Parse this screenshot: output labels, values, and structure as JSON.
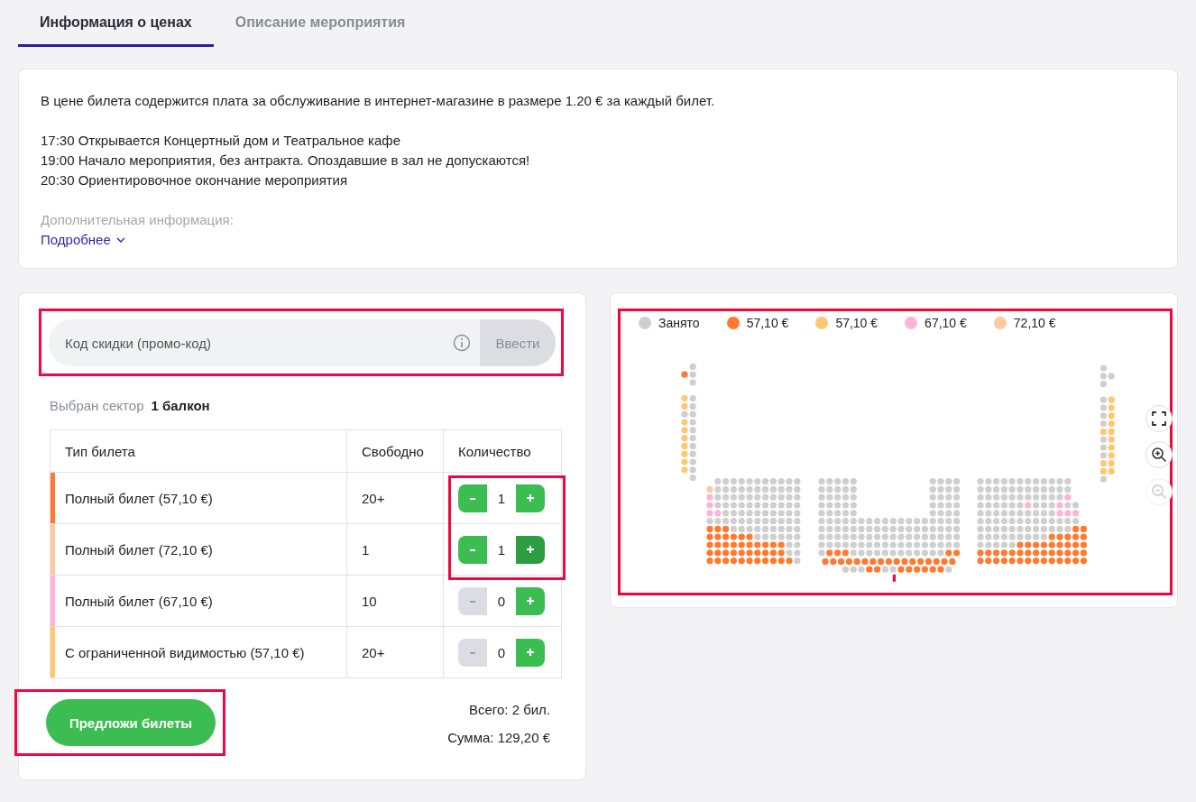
{
  "tabs": [
    {
      "label": "Информация о ценах",
      "selected": true
    },
    {
      "label": "Описание мероприятия",
      "selected": false
    }
  ],
  "info": {
    "fee_note": "В цене билета содержится плата за обслуживание в интернет-магазине в размере 1.20 € за каждый билет.",
    "schedule": [
      "17:30 Открывается Концертный дом и Театральное кафе",
      "19:00 Начало мероприятия, без антракта. Опоздавшие в зал не допускаются!",
      "20:30 Ориентировочное окончание мероприятия"
    ],
    "extra_label": "Дополнительная информация:",
    "more_link": "Подробнее"
  },
  "promo": {
    "placeholder": "Код скидки (промо-код)",
    "button": "Ввести",
    "highlighted": true
  },
  "sector": {
    "label": "Выбран сектор",
    "value": "1 балкон"
  },
  "table": {
    "columns": [
      "Тип билета",
      "Свободно",
      "Количество"
    ],
    "rows": [
      {
        "type": "Полный билет (57,10 €)",
        "available": "20+",
        "color": "#ff7a2f",
        "quantity": "1",
        "minus_disabled": false,
        "plus_pressed": false,
        "highlighted": true
      },
      {
        "type": "Полный билет (72,10 €)",
        "available": "1",
        "color": "#ffc9a0",
        "quantity": "1",
        "minus_disabled": false,
        "plus_pressed": true,
        "highlighted": true
      },
      {
        "type": "Полный билет (67,10 €)",
        "available": "10",
        "color": "#ffb3d6",
        "quantity": "0",
        "minus_disabled": true,
        "plus_pressed": false,
        "highlighted": false
      },
      {
        "type": "С ограниченной видимостью (57,10 €)",
        "available": "20+",
        "color": "#ffc870",
        "quantity": "0",
        "minus_disabled": true,
        "plus_pressed": false,
        "highlighted": false
      }
    ]
  },
  "offer_button": {
    "label": "Предложи билеты",
    "highlighted": true
  },
  "totals": {
    "count": "Всего: 2 бил.",
    "sum": "Сумма: 129,20 €"
  },
  "seat_map": {
    "highlighted": true,
    "legend": [
      {
        "label": "Занято",
        "color": "#cfcfcf"
      },
      {
        "label": "57,10 €",
        "color": "#ff7a2f"
      },
      {
        "label": "57,10 €",
        "color": "#ffc870"
      },
      {
        "label": "67,10 €",
        "color": "#ffb3d6"
      },
      {
        "label": "72,10 €",
        "color": "#ffc9a0"
      }
    ]
  }
}
